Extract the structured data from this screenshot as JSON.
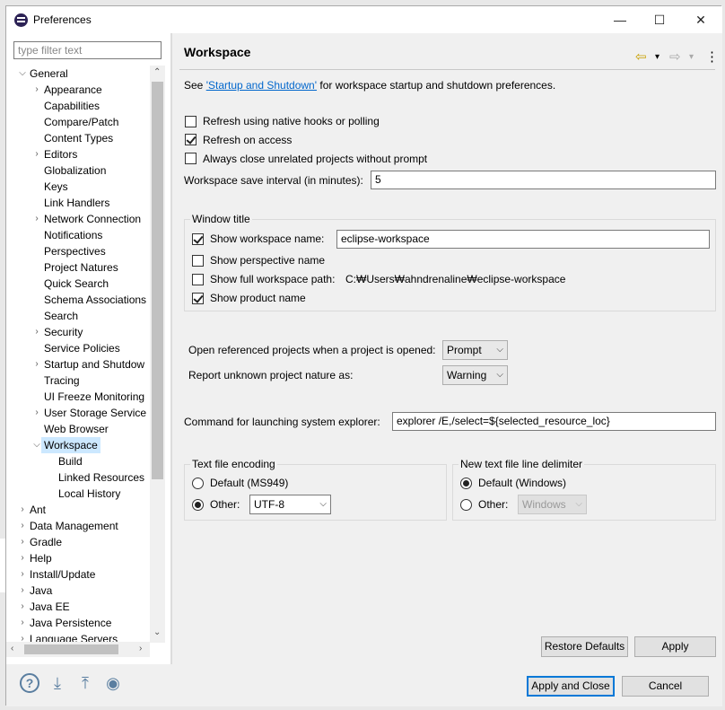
{
  "window": {
    "title": "Preferences",
    "minimize": "—",
    "maximize": "☐",
    "close": "✕"
  },
  "filter": {
    "placeholder": "type filter text"
  },
  "tree": {
    "items": [
      {
        "label": "General",
        "level": 0,
        "arrow": "⌵"
      },
      {
        "label": "Appearance",
        "level": 1,
        "arrow": "›"
      },
      {
        "label": "Capabilities",
        "level": 1,
        "arrow": ""
      },
      {
        "label": "Compare/Patch",
        "level": 1,
        "arrow": ""
      },
      {
        "label": "Content Types",
        "level": 1,
        "arrow": ""
      },
      {
        "label": "Editors",
        "level": 1,
        "arrow": "›"
      },
      {
        "label": "Globalization",
        "level": 1,
        "arrow": ""
      },
      {
        "label": "Keys",
        "level": 1,
        "arrow": ""
      },
      {
        "label": "Link Handlers",
        "level": 1,
        "arrow": ""
      },
      {
        "label": "Network Connection",
        "level": 1,
        "arrow": "›"
      },
      {
        "label": "Notifications",
        "level": 1,
        "arrow": ""
      },
      {
        "label": "Perspectives",
        "level": 1,
        "arrow": ""
      },
      {
        "label": "Project Natures",
        "level": 1,
        "arrow": ""
      },
      {
        "label": "Quick Search",
        "level": 1,
        "arrow": ""
      },
      {
        "label": "Schema Associations",
        "level": 1,
        "arrow": ""
      },
      {
        "label": "Search",
        "level": 1,
        "arrow": ""
      },
      {
        "label": "Security",
        "level": 1,
        "arrow": "›"
      },
      {
        "label": "Service Policies",
        "level": 1,
        "arrow": ""
      },
      {
        "label": "Startup and Shutdow",
        "level": 1,
        "arrow": "›"
      },
      {
        "label": "Tracing",
        "level": 1,
        "arrow": ""
      },
      {
        "label": "UI Freeze Monitoring",
        "level": 1,
        "arrow": ""
      },
      {
        "label": "User Storage Service",
        "level": 1,
        "arrow": "›"
      },
      {
        "label": "Web Browser",
        "level": 1,
        "arrow": ""
      },
      {
        "label": "Workspace",
        "level": 1,
        "arrow": "⌵",
        "selected": true
      },
      {
        "label": "Build",
        "level": 2,
        "arrow": ""
      },
      {
        "label": "Linked Resources",
        "level": 2,
        "arrow": ""
      },
      {
        "label": "Local History",
        "level": 2,
        "arrow": ""
      },
      {
        "label": "Ant",
        "level": 0,
        "arrow": "›"
      },
      {
        "label": "Data Management",
        "level": 0,
        "arrow": "›"
      },
      {
        "label": "Gradle",
        "level": 0,
        "arrow": "›"
      },
      {
        "label": "Help",
        "level": 0,
        "arrow": "›"
      },
      {
        "label": "Install/Update",
        "level": 0,
        "arrow": "›"
      },
      {
        "label": "Java",
        "level": 0,
        "arrow": "›"
      },
      {
        "label": "Java EE",
        "level": 0,
        "arrow": "›"
      },
      {
        "label": "Java Persistence",
        "level": 0,
        "arrow": "›"
      },
      {
        "label": "Language Servers",
        "level": 0,
        "arrow": "›"
      }
    ]
  },
  "page": {
    "title": "Workspace",
    "see_prefix": "See ",
    "see_link": "'Startup and Shutdown'",
    "see_suffix": " for workspace startup and shutdown preferences.",
    "refresh_native": "Refresh using native hooks or polling",
    "refresh_access": "Refresh on access",
    "always_close": "Always close unrelated projects without prompt",
    "save_interval_label": "Workspace save interval (in minutes):",
    "save_interval_value": "5"
  },
  "window_title_group": {
    "title": "Window title",
    "show_workspace_name": "Show workspace name:",
    "workspace_name_value": "eclipse-workspace",
    "show_perspective": "Show perspective name",
    "show_full_path": "Show full workspace path:",
    "full_path_value": "C:₩Users₩ahndrenaline₩eclipse-workspace",
    "show_product": "Show product name"
  },
  "projects": {
    "open_ref_label": "Open referenced projects when a project is opened:",
    "open_ref_value": "Prompt",
    "unknown_nature_label": "Report unknown project nature as:",
    "unknown_nature_value": "Warning"
  },
  "explorer": {
    "label": "Command for launching system explorer:",
    "value": "explorer /E,/select=${selected_resource_loc}"
  },
  "encoding": {
    "title": "Text file encoding",
    "default_label": "Default (MS949)",
    "other_label": "Other:",
    "other_value": "UTF-8"
  },
  "delimiter": {
    "title": "New text file line delimiter",
    "default_label": "Default (Windows)",
    "other_label": "Other:",
    "other_value": "Windows"
  },
  "buttons": {
    "restore_defaults": "Restore Defaults",
    "apply": "Apply",
    "apply_close": "Apply and Close",
    "cancel": "Cancel"
  },
  "icons": {
    "back": "⇦",
    "forward": "⇨",
    "dropdown": "▾",
    "menu": "⋮",
    "help": "?",
    "import": "⤓",
    "export": "⤒",
    "record": "◉"
  }
}
